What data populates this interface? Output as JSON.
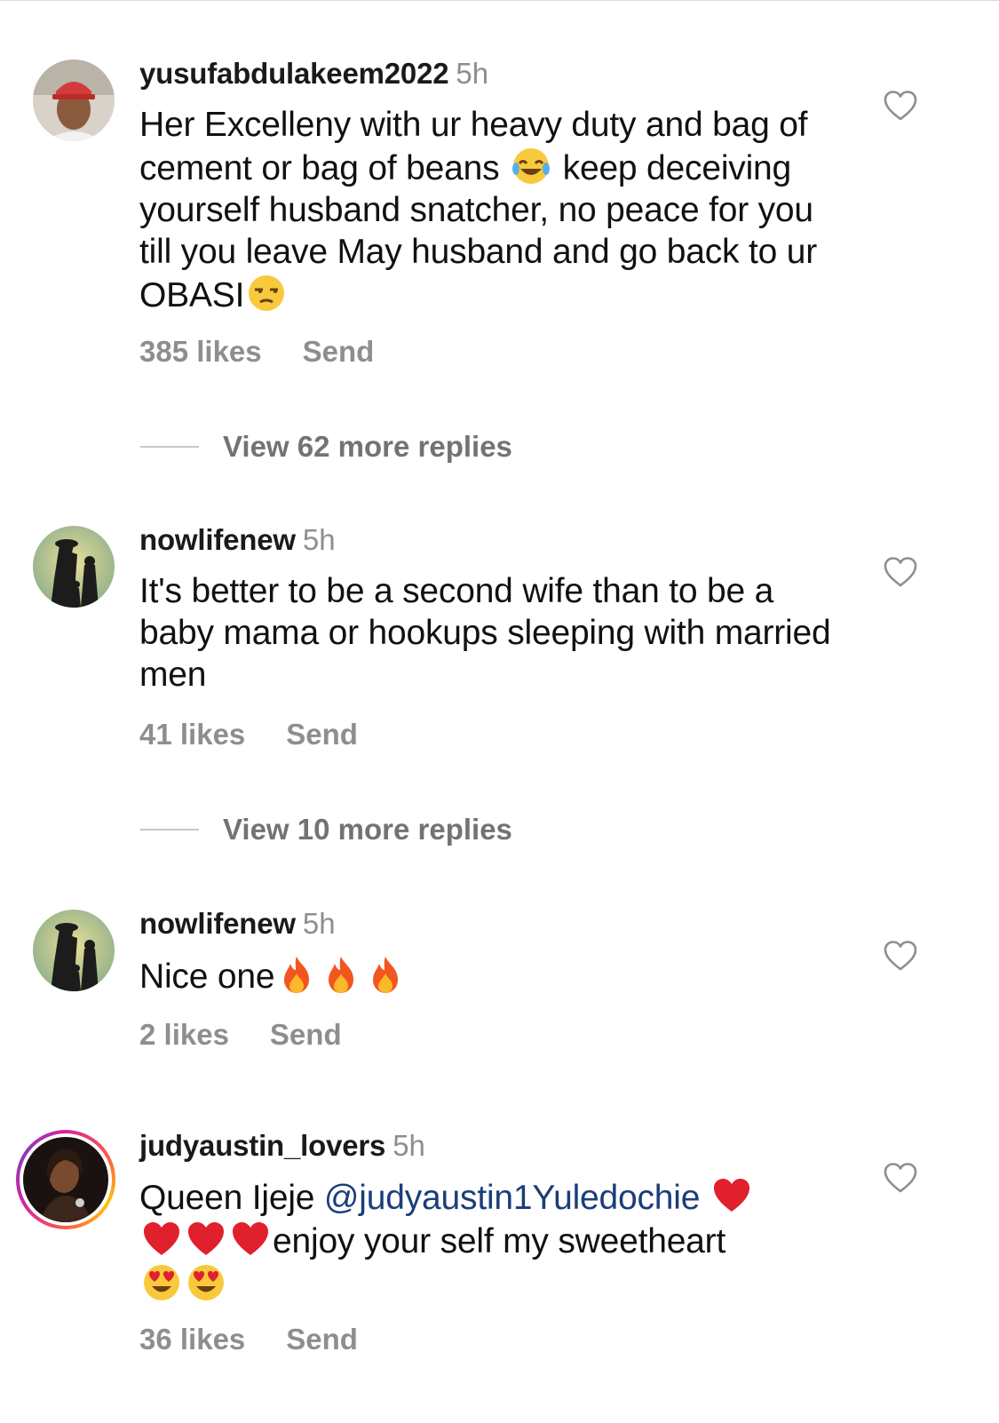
{
  "comments": [
    {
      "username": "yusufabdulakeem2022",
      "time": "5h",
      "text_parts": [
        "Her Excelleny with ur heavy duty and bag of cement or bag of beans ",
        " keep deceiving yourself husband snatcher,  no peace for you till you leave May husband and go back to ur OBASI"
      ],
      "emojis": [
        "tears-of-joy-emoji",
        "unamused-face-emoji"
      ],
      "likes": "385 likes",
      "send": "Send",
      "replies": "View 62 more replies"
    },
    {
      "username": "nowlifenew",
      "time": "5h",
      "text": "It's better to be a second wife than to be a baby mama or hookups sleeping with married men",
      "likes": "41 likes",
      "send": "Send",
      "replies": "View 10 more replies"
    },
    {
      "username": "nowlifenew",
      "time": "5h",
      "text": "Nice one",
      "emojis": [
        "fire-emoji",
        "fire-emoji",
        "fire-emoji"
      ],
      "likes": "2 likes",
      "send": "Send"
    },
    {
      "username": "judyaustin_lovers",
      "time": "5h",
      "text_prefix": "Queen Ijeje ",
      "mention": "@judyaustin1Yuledochie",
      "text_suffix": "enjoy your self my sweetheart",
      "emojis": [
        "red-heart-emoji",
        "red-heart-emoji",
        "red-heart-emoji",
        "red-heart-emoji",
        "heart-eyes-emoji",
        "heart-eyes-emoji"
      ],
      "likes": "36 likes",
      "send": "Send"
    }
  ],
  "colors": {
    "username": "#1a1a1a",
    "meta": "#8e8e8e",
    "mention": "#1b3d7a",
    "story_ring": [
      "#d6249f",
      "#fd5949",
      "#fdc70a"
    ]
  }
}
